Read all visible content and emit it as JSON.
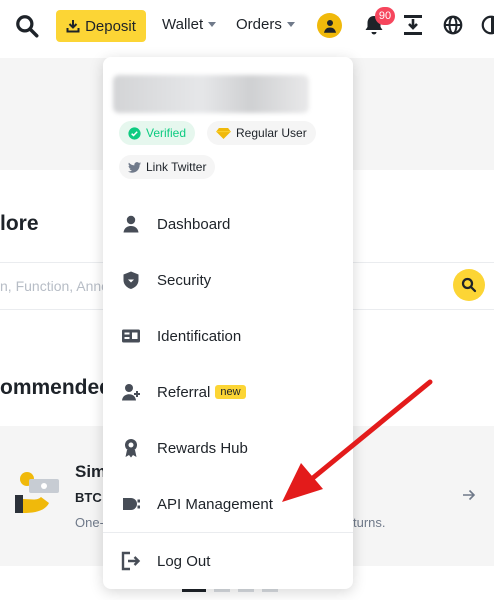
{
  "header": {
    "deposit_label": "Deposit",
    "wallet_label": "Wallet",
    "orders_label": "Orders",
    "notification_count": "90"
  },
  "page": {
    "explore_title": "lore",
    "search_placeholder": "n, Function, Anno",
    "recommended_title": "ommended",
    "card_title": "Sim",
    "card_subtitle": "BTC",
    "card_description_left": "One-",
    "card_description_right": "turns."
  },
  "menu": {
    "tags": {
      "verified": "Verified",
      "user_level": "Regular User",
      "link_twitter": "Link Twitter"
    },
    "items": [
      {
        "label": "Dashboard",
        "icon": "user-icon"
      },
      {
        "label": "Security",
        "icon": "shield-icon"
      },
      {
        "label": "Identification",
        "icon": "id-card-icon"
      },
      {
        "label": "Referral",
        "icon": "add-user-icon",
        "badge": "new"
      },
      {
        "label": "Rewards Hub",
        "icon": "medal-icon"
      },
      {
        "label": "API Management",
        "icon": "api-icon"
      },
      {
        "label": "Log Out",
        "icon": "logout-icon"
      }
    ]
  },
  "colors": {
    "brand_yellow": "#fcd535",
    "verified_green": "#0ecb81",
    "badge_red": "#f6465d",
    "annotation_red": "#e31b1b"
  },
  "pager": {
    "active_page": 1,
    "total_pages": 4
  }
}
